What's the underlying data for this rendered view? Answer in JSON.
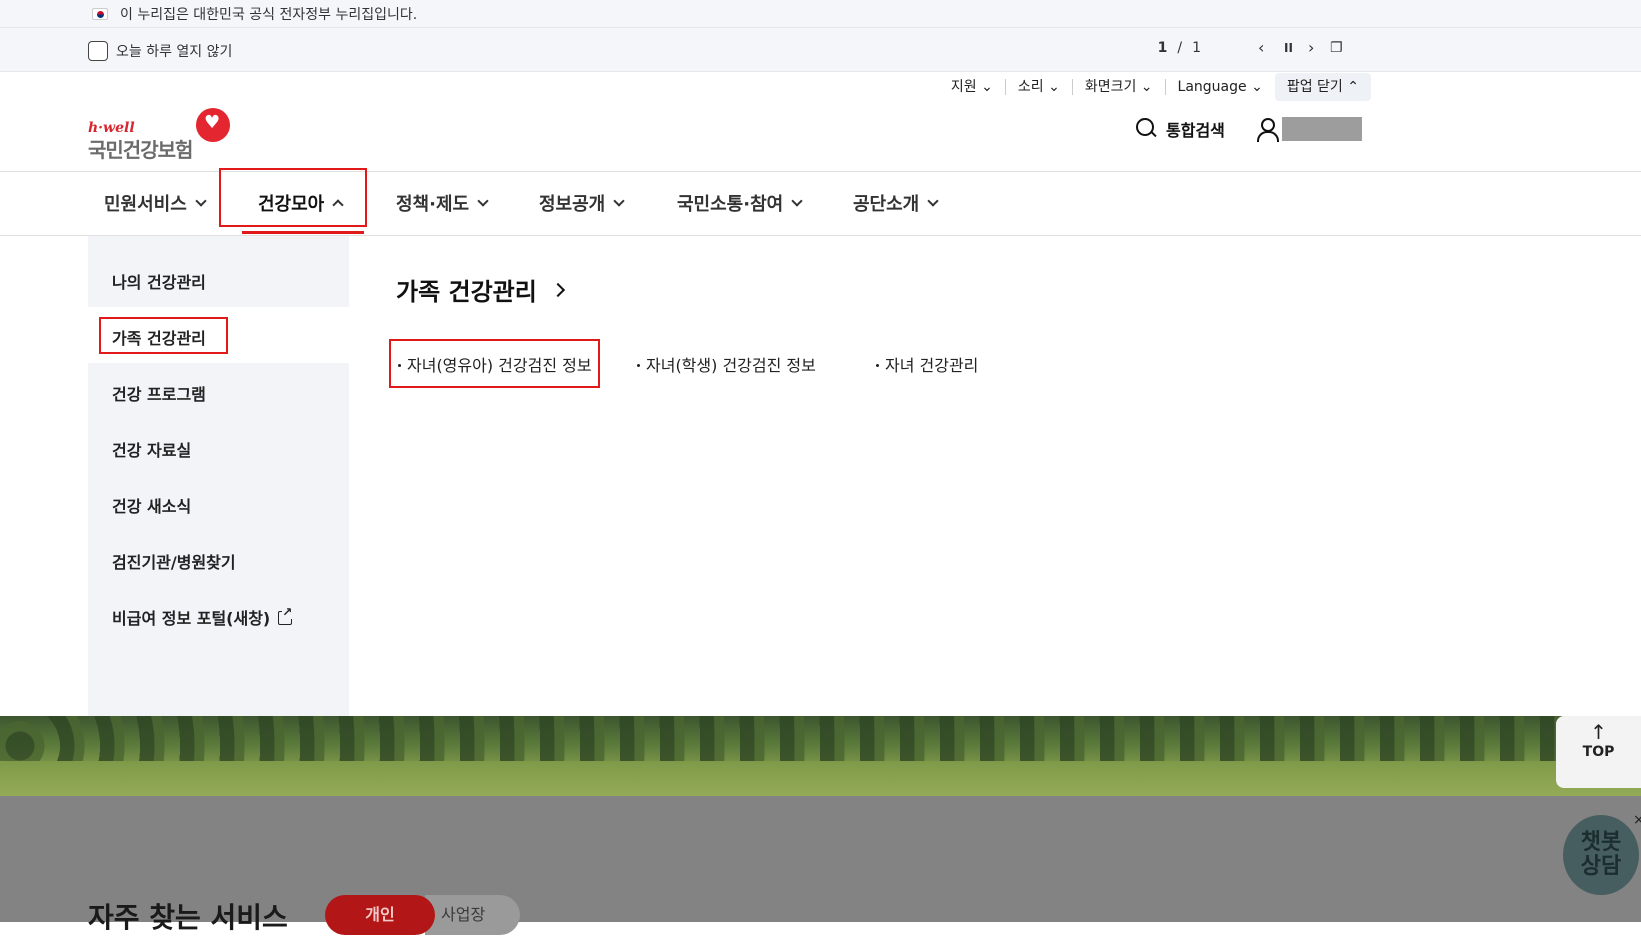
{
  "gov_banner": {
    "text": "이 누리집은 대한민국 공식 전자정부 누리집입니다."
  },
  "popup": {
    "dont_open_today": "오늘 하루 열지 않기",
    "page_current": "1",
    "page_sep": "/",
    "page_total": "1",
    "controls": {
      "prev": "‹",
      "pause": "II",
      "next": "›",
      "window": "❐"
    }
  },
  "util": {
    "support": "지원",
    "sound": "소리",
    "screen_size": "화면크기",
    "language": "Language",
    "popup_close": "팝업 닫기"
  },
  "logo": {
    "tagline": "h·well",
    "name": "국민건강보험"
  },
  "header": {
    "search_label": "통합검색"
  },
  "gnb": {
    "items": [
      {
        "label": "민원서비스",
        "expanded": false
      },
      {
        "label": "건강모아",
        "expanded": true
      },
      {
        "label": "정책·제도",
        "expanded": false
      },
      {
        "label": "정보공개",
        "expanded": false
      },
      {
        "label": "국민소통·참여",
        "expanded": false
      },
      {
        "label": "공단소개",
        "expanded": false
      }
    ]
  },
  "sidebar": {
    "items": [
      {
        "label": "나의 건강관리"
      },
      {
        "label": "가족 건강관리",
        "selected": true
      },
      {
        "label": "건강 프로그램"
      },
      {
        "label": "건강 자료실"
      },
      {
        "label": "건강 새소식"
      },
      {
        "label": "검진기관/병원찾기"
      },
      {
        "label": "비급여 정보 포털(새창)",
        "external": true
      }
    ]
  },
  "section": {
    "title": "가족 건강관리",
    "links": [
      {
        "label": "자녀(영유아) 건강검진 정보",
        "highlighted": true
      },
      {
        "label": "자녀(학생) 건강검진 정보"
      },
      {
        "label": "자녀 건강관리"
      }
    ]
  },
  "footer": {
    "frequent_services": "자주 찾는 서비스",
    "tab_personal": "개인",
    "tab_business": "사업장"
  },
  "floating": {
    "top_label": "TOP",
    "top_arrow": "↑",
    "chatbot_line1": "챗봇",
    "chatbot_line2": "상담",
    "chatbot_close": "×"
  },
  "colors": {
    "accent_red": "#e11919",
    "brand_red": "#d7262f",
    "sidebar_bg": "#f2f4f8"
  }
}
